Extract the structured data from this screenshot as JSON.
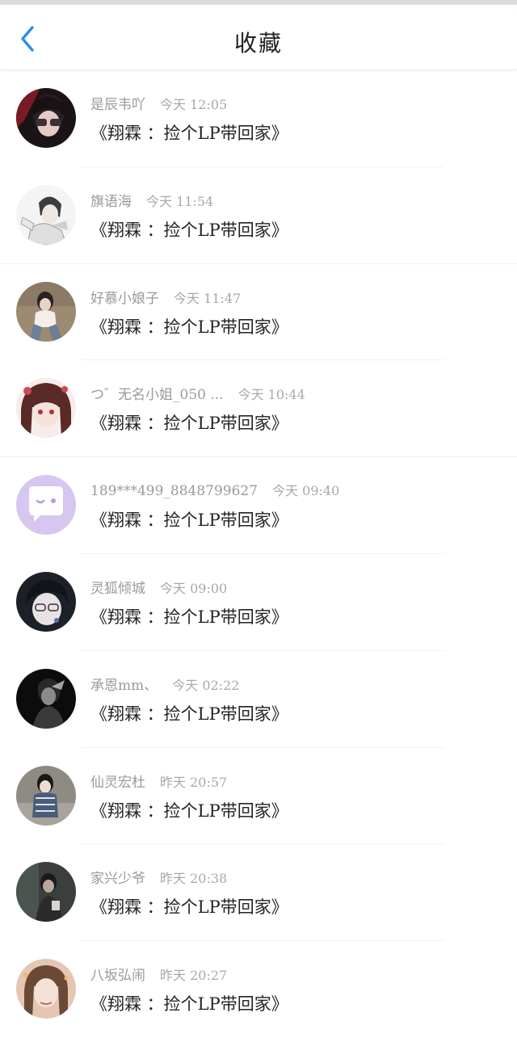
{
  "header": {
    "title": "收藏",
    "back_icon": "back-chevron-icon",
    "accent_color": "#2b8fe6"
  },
  "items": [
    {
      "name": "是辰韦吖",
      "time": "今天 12:05",
      "content": "《翔霖 ：捡个LP带回家》"
    },
    {
      "name": "旗语海",
      "time": "今天 11:54",
      "content": "《翔霖 ：捡个LP带回家》"
    },
    {
      "name": "好慕小娘子",
      "time": "今天 11:47",
      "content": "《翔霖 ：捡个LP带回家》"
    },
    {
      "name": "つ゛无名小姐_050 ...",
      "time": "今天 10:44",
      "content": "《翔霖 ：捡个LP带回家》"
    },
    {
      "name": "189***499_8848799627",
      "time": "今天 09:40",
      "content": "《翔霖 ：捡个LP带回家》"
    },
    {
      "name": "灵狐倾城",
      "time": "今天 09:00",
      "content": "《翔霖 ：捡个LP带回家》"
    },
    {
      "name": "承恩mm、",
      "time": "今天 02:22",
      "content": "《翔霖 ：捡个LP带回家》"
    },
    {
      "name": "仙灵宏杜",
      "time": "昨天 20:57",
      "content": "《翔霖 ：捡个LP带回家》"
    },
    {
      "name": "家兴少爷",
      "time": "昨天 20:38",
      "content": "《翔霖 ：捡个LP带回家》"
    },
    {
      "name": "八坂弘闹",
      "time": "昨天 20:27",
      "content": "《翔霖 ：捡个LP带回家》"
    }
  ]
}
